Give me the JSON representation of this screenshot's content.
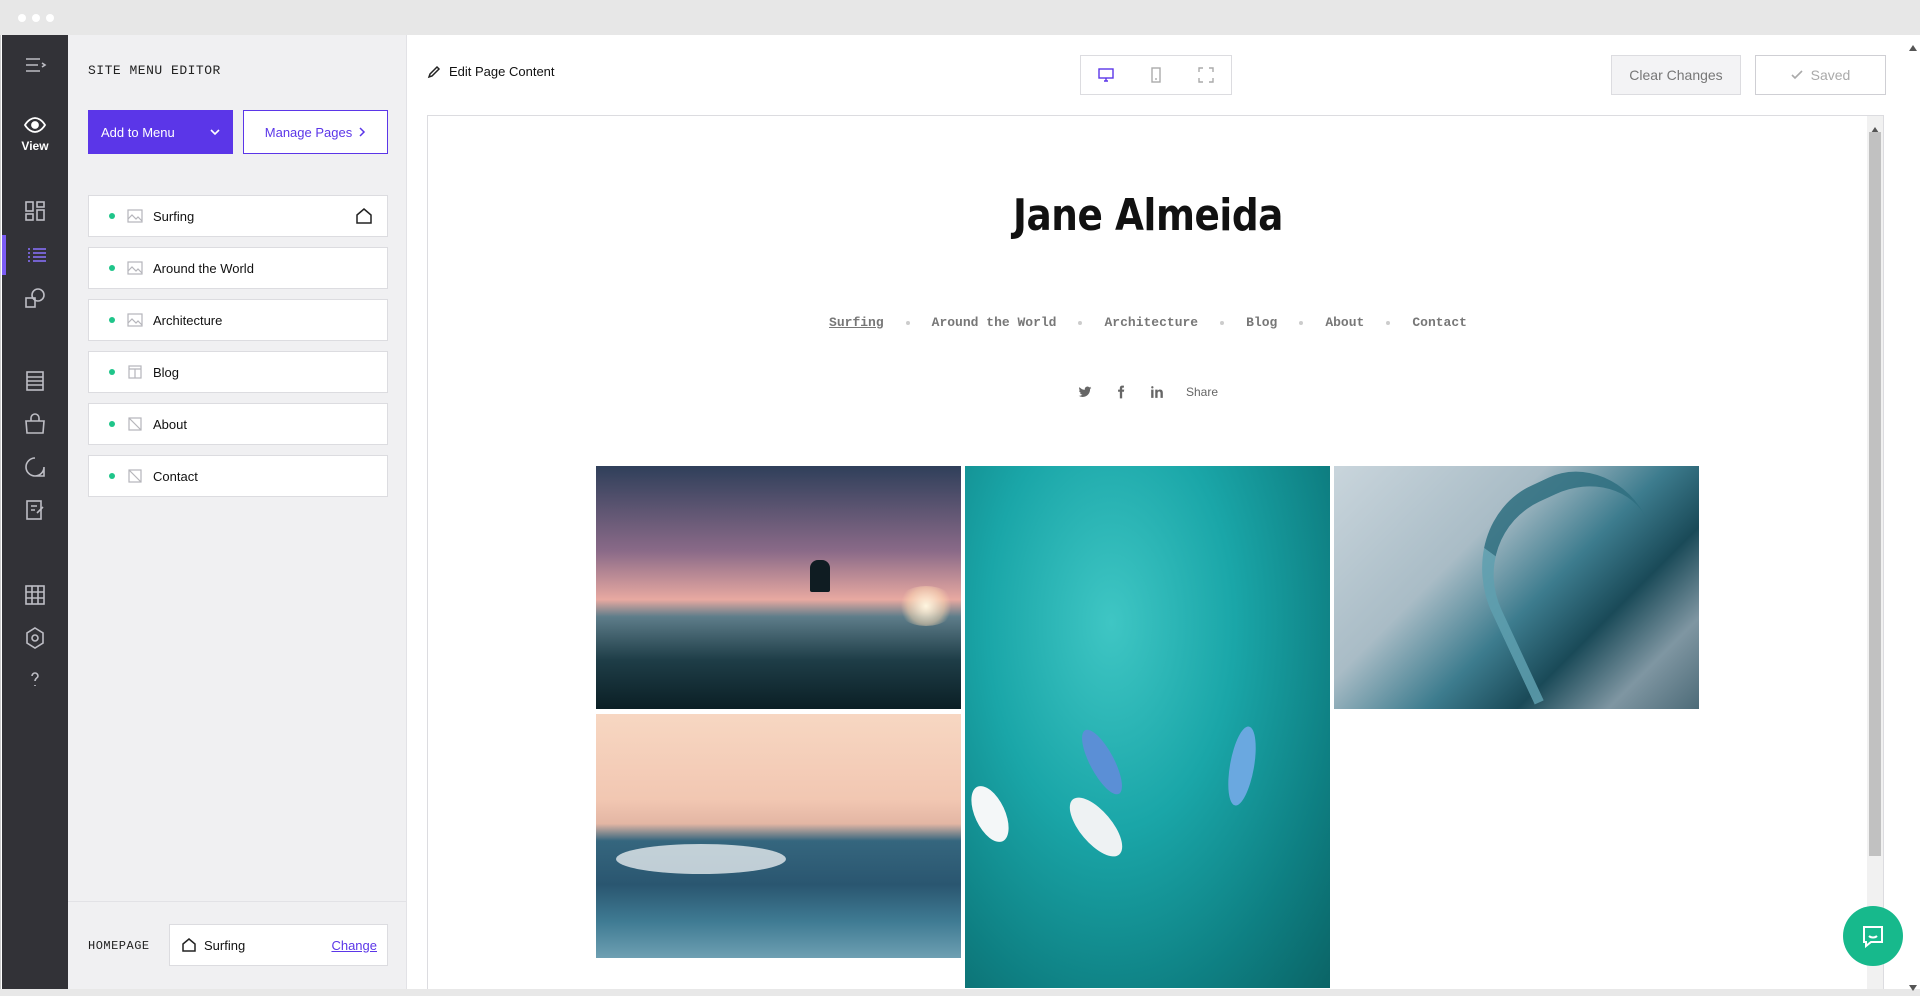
{
  "panel": {
    "title": "SITE MENU EDITOR",
    "add_to_menu": "Add to Menu",
    "manage_pages": "Manage Pages",
    "menu_items": [
      {
        "label": "Surfing",
        "icon": "gallery-page-icon",
        "is_homepage": true
      },
      {
        "label": "Around the World",
        "icon": "gallery-page-icon"
      },
      {
        "label": "Architecture",
        "icon": "gallery-page-icon"
      },
      {
        "label": "Blog",
        "icon": "blog-page-icon"
      },
      {
        "label": "About",
        "icon": "blank-page-icon"
      },
      {
        "label": "Contact",
        "icon": "blank-page-icon"
      }
    ],
    "homepage_label": "HOMEPAGE",
    "homepage_value": "Surfing",
    "homepage_change": "Change"
  },
  "rail": {
    "view_label": "View"
  },
  "toolbar": {
    "edit_page_content": "Edit Page Content",
    "clear_changes": "Clear Changes",
    "saved": "Saved"
  },
  "site": {
    "title": "Jane Almeida",
    "nav": [
      "Surfing",
      "Around the World",
      "Architecture",
      "Blog",
      "About",
      "Contact"
    ],
    "share": "Share"
  },
  "colors": {
    "accent": "#5b36e8",
    "rail": "#323237",
    "status_dot": "#1fc58a",
    "chat": "#17b98c"
  }
}
